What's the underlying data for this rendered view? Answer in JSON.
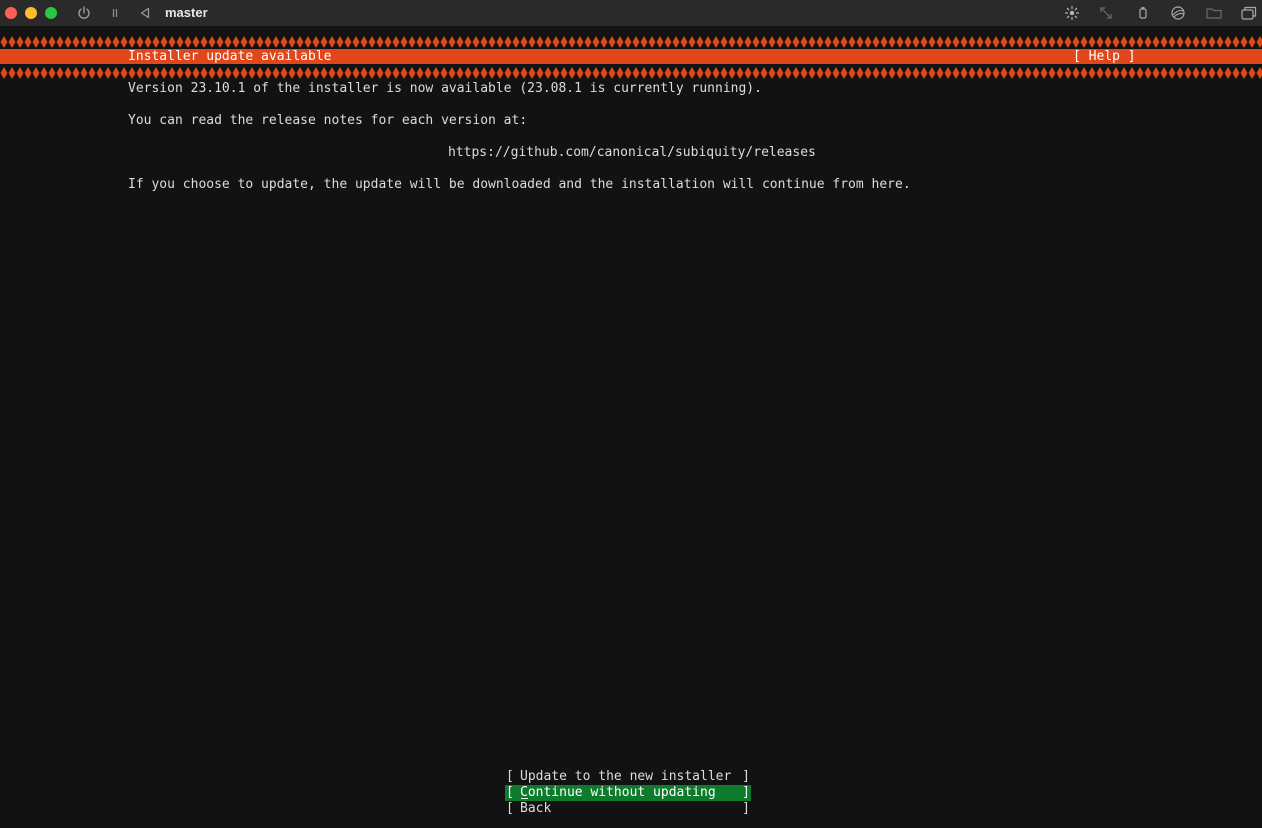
{
  "window": {
    "title": "master",
    "toolbar_icons": [
      "power-icon",
      "pause-icon",
      "back-icon",
      "brightness-icon",
      "resize-icon",
      "usb-icon",
      "network-icon",
      "folder-icon",
      "windows-icon"
    ]
  },
  "installer": {
    "screen_title": "Installer update available",
    "help_label": "[ Help ]",
    "lines": {
      "version_notice": "Version 23.10.1 of the installer is now available (23.08.1 is currently running).",
      "release_notes": "You can read the release notes for each version at:",
      "release_url": "https://github.com/canonical/subiquity/releases",
      "update_info": "If you choose to update, the update will be downloaded and the installation will continue from here."
    },
    "menu": [
      {
        "label": "Update to the new installer",
        "selected": false
      },
      {
        "label": "Continue without updating",
        "selected": true
      },
      {
        "label": "Back",
        "selected": false
      }
    ],
    "bracket_open": "[",
    "bracket_close": "]"
  },
  "colors": {
    "accent": "#e2461b",
    "selection": "#0e7a2b",
    "background": "#121212",
    "toolbar": "#2a2a2a"
  }
}
